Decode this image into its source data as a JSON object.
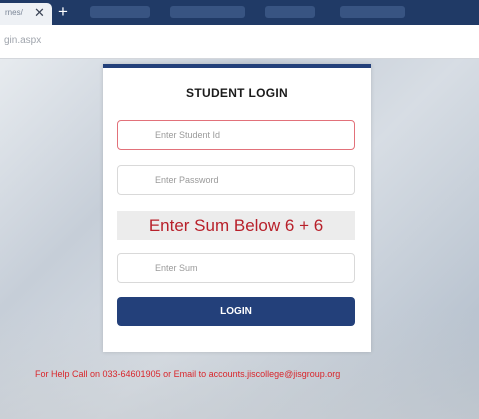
{
  "browser": {
    "tab_title": "rnes/",
    "tab_close": "✕",
    "new_tab": "+",
    "url": "gin.aspx"
  },
  "login": {
    "title": "STUDENT LOGIN",
    "student_id_placeholder": "Enter Student Id",
    "password_placeholder": "Enter Password",
    "captcha_text": "Enter Sum Below 6 + 6",
    "sum_placeholder": "Enter Sum",
    "login_label": "LOGIN"
  },
  "help_text": "For Help Call on 033-64601905 or Email to accounts.jiscollege@jisgroup.org",
  "colors": {
    "primary": "#23407a",
    "error": "#e2717a",
    "captcha_text": "#b8202a",
    "help_text": "#d9262b"
  }
}
